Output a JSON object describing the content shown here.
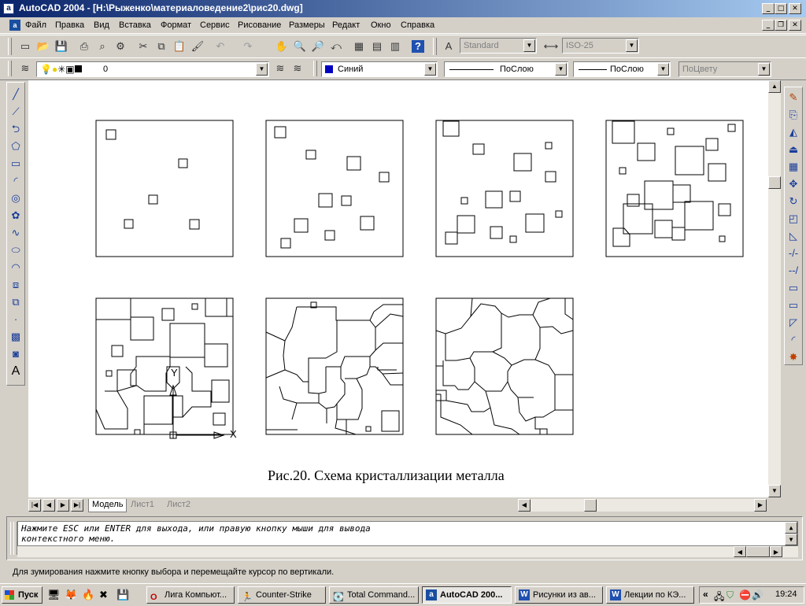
{
  "window": {
    "title": "AutoCAD 2004 - [H:\\Рыженко\\материаловедение2\\рис20.dwg]",
    "app_icon": "a"
  },
  "menu": [
    "Файл",
    "Правка",
    "Вид",
    "Вставка",
    "Формат",
    "Сервис",
    "Рисование",
    "Размеры",
    "Редакт",
    "Окно",
    "Справка"
  ],
  "toolbar": {
    "text_style": "Standard",
    "dim_style": "ISO-25",
    "layer": "0",
    "color": "Синий",
    "linetype": "ПоСлою",
    "lineweight": "ПоСлою",
    "plotstyle": "ПоЦвету",
    "accent_color": "#0000c0"
  },
  "drawing": {
    "caption": "Рис.20. Схема кристаллизации металла",
    "ucs_y": "Y",
    "ucs_x": "X"
  },
  "layout_tabs": [
    "Модель",
    "Лист1",
    "Лист2"
  ],
  "command": {
    "line1": "Нажмите ESC или ENTER для выхода, или правую кнопку мыши для вывода",
    "line2": "контекстного меню."
  },
  "status": "Для зумирования нажмите кнопку выбора и перемещайте курсор по вертикали.",
  "taskbar": {
    "start": "Пуск",
    "tasks": [
      {
        "label": "Лига Компьют...",
        "icon": "opera-icon"
      },
      {
        "label": "Counter-Strike",
        "icon": "game-icon"
      },
      {
        "label": "Total Command...",
        "icon": "disk-icon"
      },
      {
        "label": "AutoCAD 200...",
        "icon": "autocad-icon",
        "active": true
      },
      {
        "label": "Рисунки из ав...",
        "icon": "word-icon"
      },
      {
        "label": "Лекции по КЭ...",
        "icon": "word-icon"
      }
    ],
    "tray_arrows": "«",
    "clock": "19:24"
  }
}
